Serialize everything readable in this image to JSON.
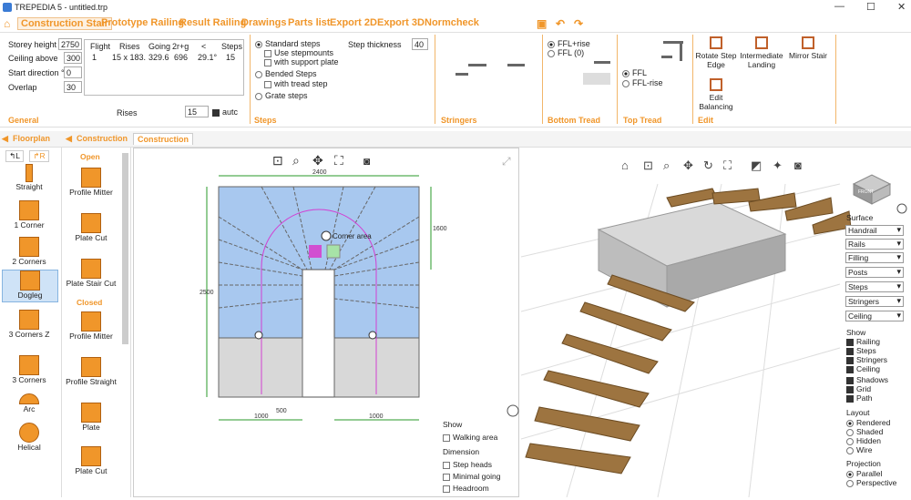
{
  "window": {
    "title": "TREPEDIA 5 - untitled.trp"
  },
  "menu": {
    "construction": "Construction Stair",
    "prototype": "Prototype Railing",
    "result": "Result Railing",
    "drawings": "Drawings",
    "parts": "Parts list",
    "export2d": "Export 2D",
    "export3d": "Export 3D",
    "normcheck": "Normcheck"
  },
  "general": {
    "title": "General",
    "storey_label": "Storey height",
    "storey": "2750",
    "ceiling_label": "Ceiling above",
    "ceiling": "300",
    "start_label": "Start direction °",
    "start": "0",
    "overlap_label": "Overlap",
    "overlap": "30",
    "rises_label": "Rises",
    "rises": "15",
    "autc": "autc",
    "cols": [
      "Flight",
      "Rises",
      "Going",
      "2r+g",
      "<",
      "Steps"
    ],
    "row": [
      "1",
      "15 x 183.",
      "329.6",
      "696",
      "29.1°",
      "15"
    ]
  },
  "steps": {
    "title": "Steps",
    "standard": "Standard steps",
    "stepmounts": "Use stepmounts",
    "support": "with support plate",
    "bended": "Bended Steps",
    "tread": "with tread step",
    "grate": "Grate steps",
    "thickness_label": "Step thickness",
    "thickness": "40"
  },
  "stringers": {
    "title": "Stringers"
  },
  "bottom": {
    "title": "Bottom Tread",
    "opt1": "FFL+rise",
    "opt2": "FFL (0)"
  },
  "top": {
    "title": "Top Tread",
    "opt1": "FFL",
    "opt2": "FFL-rise"
  },
  "edit": {
    "title": "Edit",
    "rotate": "Rotate Step Edge",
    "intermediate": "Intermediate Landing",
    "mirror": "Mirror Stair",
    "balancing": "Edit Balancing"
  },
  "tabs": {
    "floorplan": "Floorplan",
    "construction": "Construction",
    "construction_tab": "Construction"
  },
  "left": {
    "tab_l": "L",
    "tab_r": "R",
    "items": [
      "Straight",
      "1 Corner",
      "2 Corners",
      "Dogleg",
      "3 Corners Z",
      "3 Corners",
      "Arc",
      "Helical"
    ]
  },
  "mid": {
    "open": "Open",
    "closed": "Closed",
    "items": [
      "Profile Mitter",
      "Plate Cut",
      "Plate Stair Cut",
      "Profile Mitter",
      "Profile Straight",
      "Plate",
      "Plate Cut"
    ]
  },
  "plan": {
    "dim_top": "2400",
    "dim_left": "2500",
    "dim_right": "1600",
    "dim_b1": "1000",
    "dim_b2": "500",
    "dim_b3": "1000",
    "corner": "Corner area"
  },
  "show2d": {
    "title": "Show",
    "walking": "Walking area",
    "dim_title": "Dimension",
    "stepheads": "Step heads",
    "going": "Minimal going",
    "headroom": "Headroom"
  },
  "view3d": {
    "dropdowns": [
      "Handrail",
      "Rails",
      "Filling",
      "Posts",
      "Steps",
      "Stringers",
      "Ceiling"
    ],
    "surface": "Surface",
    "show_title": "Show",
    "show": [
      "Railing",
      "Steps",
      "Stringers",
      "Ceiling",
      "Shadows",
      "Grid",
      "Path"
    ],
    "layout_title": "Layout",
    "layout": [
      "Rendered",
      "Shaded",
      "Hidden",
      "Wire"
    ],
    "proj_title": "Projection",
    "proj": [
      "Parallel",
      "Perspective"
    ],
    "cube": "FRONT"
  }
}
